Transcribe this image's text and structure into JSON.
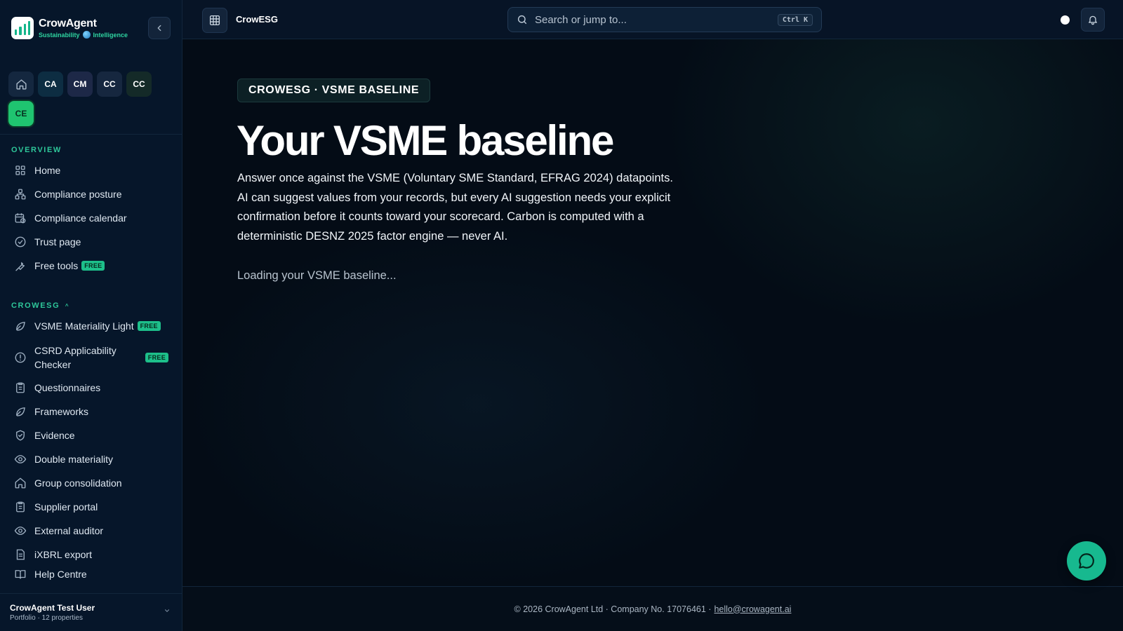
{
  "brand": {
    "name": "CrowAgent",
    "tag_left": "Sustainability",
    "tag_right": "Intelligence"
  },
  "workspaces": [
    "CA",
    "CM",
    "CC",
    "CC",
    "CE"
  ],
  "overview": {
    "label": "OVERVIEW",
    "items": [
      {
        "label": "Home"
      },
      {
        "label": "Compliance posture"
      },
      {
        "label": "Compliance calendar"
      },
      {
        "label": "Trust page"
      },
      {
        "label": "Free tools",
        "badge": "FREE"
      }
    ]
  },
  "crowesg": {
    "label": "CROWESG",
    "chevron": "^",
    "items": [
      {
        "label": "VSME Materiality Light",
        "badge": "FREE"
      },
      {
        "label": "CSRD Applicability Checker",
        "badge": "FREE"
      },
      {
        "label": "Questionnaires"
      },
      {
        "label": "Frameworks"
      },
      {
        "label": "Evidence"
      },
      {
        "label": "Double materiality"
      },
      {
        "label": "Group consolidation"
      },
      {
        "label": "Supplier portal"
      },
      {
        "label": "External auditor"
      },
      {
        "label": "iXBRL export"
      },
      {
        "label": "Help Centre"
      }
    ]
  },
  "user": {
    "name": "CrowAgent Test User",
    "sub": "Portfolio · 12 properties"
  },
  "topbar": {
    "app_name": "CrowESG",
    "search_placeholder": "Search or jump to...",
    "search_shortcut": "Ctrl K"
  },
  "main": {
    "eyebrow": "CROWESG · VSME BASELINE",
    "title": "Your VSME baseline",
    "description": "Answer once against the VSME (Voluntary SME Standard, EFRAG 2024) datapoints. AI can suggest values from your records, but every AI suggestion needs your explicit confirmation before it counts toward your scorecard. Carbon is computed with a deterministic DESNZ 2025 factor engine — never AI.",
    "loading": "Loading your VSME baseline..."
  },
  "footer": {
    "text": "© 2026 CrowAgent Ltd · Company No. 17076461 ·",
    "email": "hello@crowagent.ai"
  },
  "colors": {
    "accent": "#1dbf8a",
    "background": "#040d17",
    "sidebar": "#06162a"
  }
}
